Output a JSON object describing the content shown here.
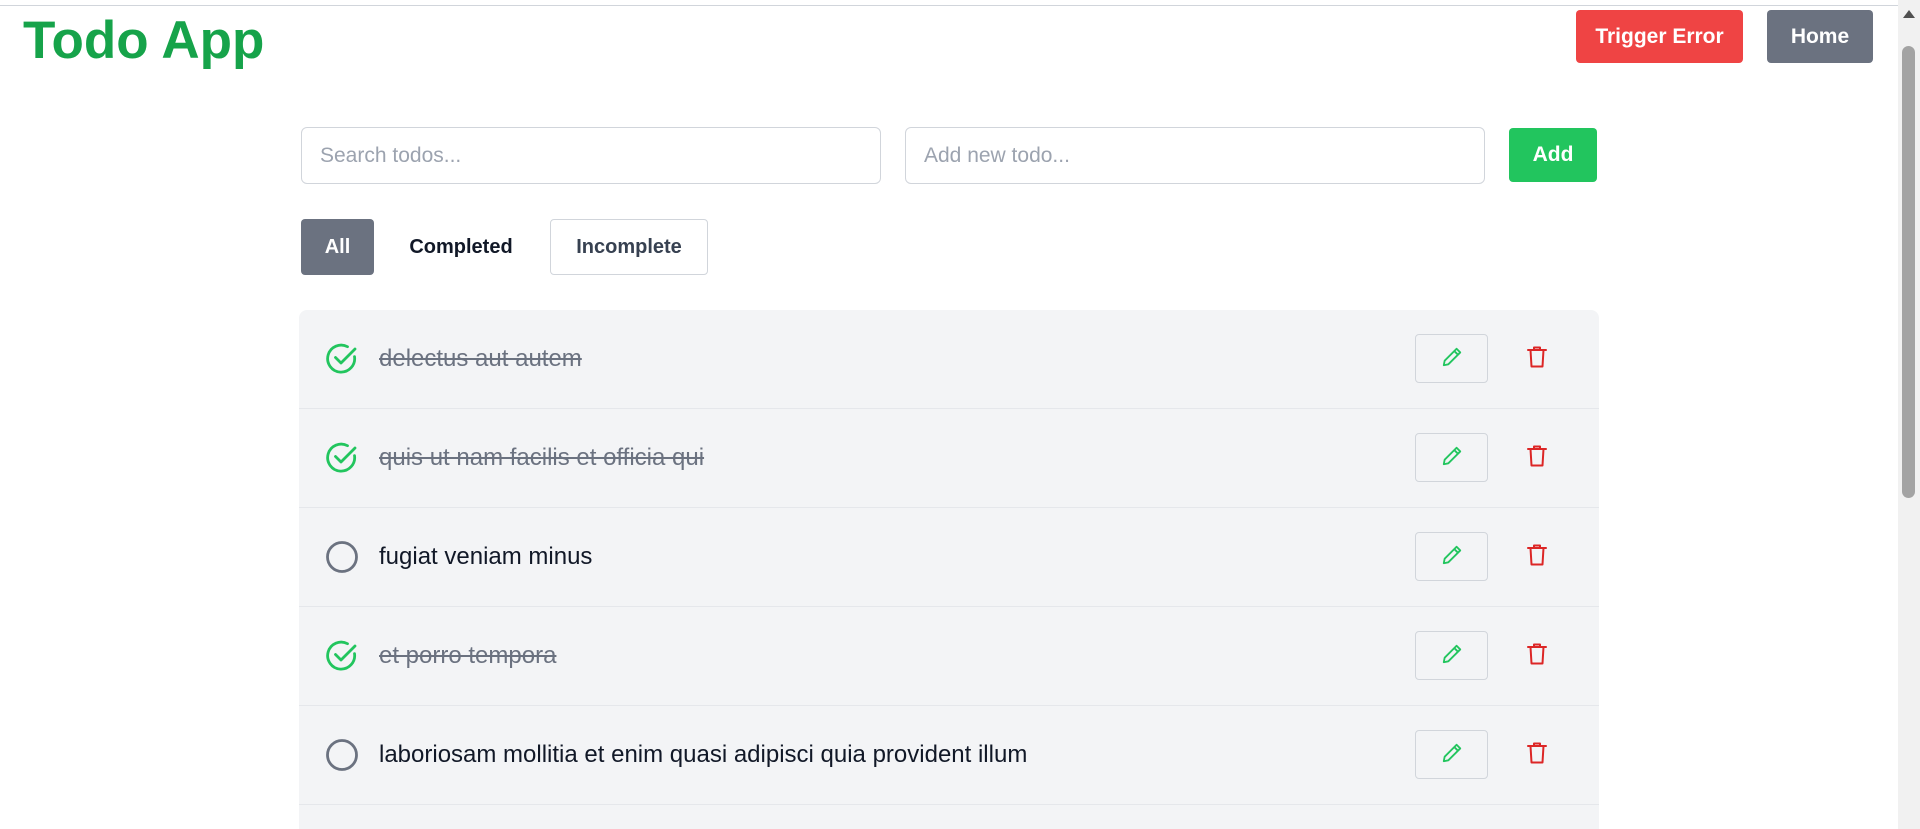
{
  "header": {
    "title": "Todo App",
    "trigger_error_label": "Trigger Error",
    "home_label": "Home"
  },
  "search": {
    "placeholder": "Search todos...",
    "value": ""
  },
  "new_todo": {
    "placeholder": "Add new todo...",
    "value": "",
    "add_label": "Add"
  },
  "filters": {
    "all": "All",
    "completed": "Completed",
    "incomplete": "Incomplete",
    "active": "All"
  },
  "todos": [
    {
      "text": "delectus aut autem",
      "completed": true
    },
    {
      "text": "quis ut nam facilis et officia qui",
      "completed": true
    },
    {
      "text": "fugiat veniam minus",
      "completed": false
    },
    {
      "text": "et porro tempora",
      "completed": true
    },
    {
      "text": "laboriosam mollitia et enim quasi adipisci quia provident illum",
      "completed": false
    }
  ],
  "icons": {
    "completed": "check-circle-icon",
    "incomplete": "empty-circle-icon",
    "edit": "pencil-icon",
    "delete": "trash-icon"
  },
  "colors": {
    "brand_green": "#16a34a",
    "add_green": "#22c55e",
    "error_red": "#ef4444",
    "gray_button": "#6b7280",
    "delete_red": "#dc2626",
    "list_background": "#f3f4f6"
  }
}
